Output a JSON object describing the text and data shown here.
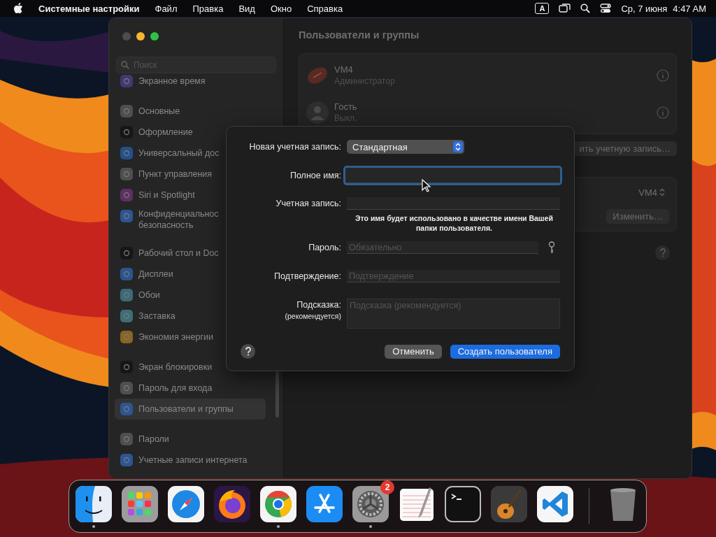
{
  "menu_bar": {
    "app_name": "Системные настройки",
    "menus": [
      "Файл",
      "Правка",
      "Вид",
      "Окно",
      "Справка"
    ],
    "input_source": "A",
    "date": "Ср, 7 июня",
    "time": "4:47 AM"
  },
  "window": {
    "sidebar": {
      "search": {
        "placeholder": "Поиск"
      },
      "groups": [
        {
          "items": [
            {
              "label": "Экранное время",
              "color": "#3f3a73",
              "selected": false
            }
          ]
        },
        {
          "items": [
            {
              "label": "Основные",
              "color": "#4f4f4f",
              "selected": false
            },
            {
              "label": "Оформление",
              "color": "#161616",
              "selected": false
            },
            {
              "label": "Универсальный дос",
              "color": "#24508a",
              "selected": false
            },
            {
              "label": "Пункт управления",
              "color": "#4f4f4f",
              "selected": false
            },
            {
              "label": "Siri и Spotlight",
              "color": "#5e2f63",
              "selected": false
            },
            {
              "label": "Конфиденциальнос\nбезопасность",
              "color": "#2c5594",
              "selected": false
            }
          ]
        },
        {
          "items": [
            {
              "label": "Рабочий стол и Doc",
              "color": "#161616",
              "selected": false
            },
            {
              "label": "Дисплеи",
              "color": "#2a5590",
              "selected": false
            },
            {
              "label": "Обои",
              "color": "#3a6a78",
              "selected": false
            },
            {
              "label": "Заставка",
              "color": "#3d6e77",
              "selected": false
            },
            {
              "label": "Экономия энергии",
              "color": "#8a6420",
              "selected": false
            }
          ]
        },
        {
          "items": [
            {
              "label": "Экран блокировки",
              "color": "#161616",
              "selected": false
            },
            {
              "label": "Пароль для входа",
              "color": "#4f4f4f",
              "selected": false
            },
            {
              "label": "Пользователи и группы",
              "color": "#2c5594",
              "selected": true
            }
          ]
        },
        {
          "items": [
            {
              "label": "Пароли",
              "color": "#4f4f4f",
              "selected": false
            },
            {
              "label": "Учетные записи интернета",
              "color": "#2c5594",
              "selected": false
            }
          ]
        }
      ]
    },
    "content": {
      "title": "Пользователи и группы",
      "users": [
        {
          "name": "VM4",
          "role": "Администратор",
          "kind": "football"
        },
        {
          "name": "Гость",
          "role": "Выкл.",
          "kind": "person"
        }
      ],
      "add_account_button": "ить учетную запись…",
      "auto_login": {
        "value": "VM4"
      },
      "edit_button": "Изменить…"
    }
  },
  "dialog": {
    "account_type": {
      "label": "Новая учетная запись:",
      "value": "Стандартная"
    },
    "fields": [
      {
        "kind": "text",
        "label": "Полное имя:",
        "focused": true
      },
      {
        "kind": "text",
        "label": "Учетная запись:",
        "focused": false,
        "note": "Это имя будет использовано в качестве имени Вашей папки пользователя."
      },
      {
        "kind": "password",
        "label": "Пароль:",
        "placeholder": "Обязательно",
        "focused": false
      },
      {
        "kind": "text",
        "label": "Подтверждение:",
        "placeholder": "Подтверждение",
        "focused": false
      },
      {
        "kind": "textarea",
        "label": "Подсказка:",
        "sublabel": "(рекомендуется)",
        "placeholder": "Подсказка (рекомендуется)",
        "focused": false
      }
    ],
    "buttons": [
      {
        "label": "Отменить",
        "primary": false
      },
      {
        "label": "Создать пользователя",
        "primary": true
      }
    ]
  },
  "dock": {
    "apps": [
      {
        "kind": "finder",
        "running": true
      },
      {
        "kind": "launchpad",
        "running": false
      },
      {
        "kind": "safari",
        "running": false
      },
      {
        "kind": "firefox",
        "running": false
      },
      {
        "kind": "chrome",
        "running": true
      },
      {
        "kind": "appstore",
        "running": false
      },
      {
        "kind": "settings",
        "running": true,
        "badge": "2"
      },
      {
        "kind": "textedit",
        "running": false
      },
      {
        "kind": "terminal",
        "running": false
      },
      {
        "kind": "garageband",
        "running": false
      },
      {
        "kind": "vscode",
        "running": false
      }
    ],
    "trash": {
      "kind": "trash"
    }
  }
}
